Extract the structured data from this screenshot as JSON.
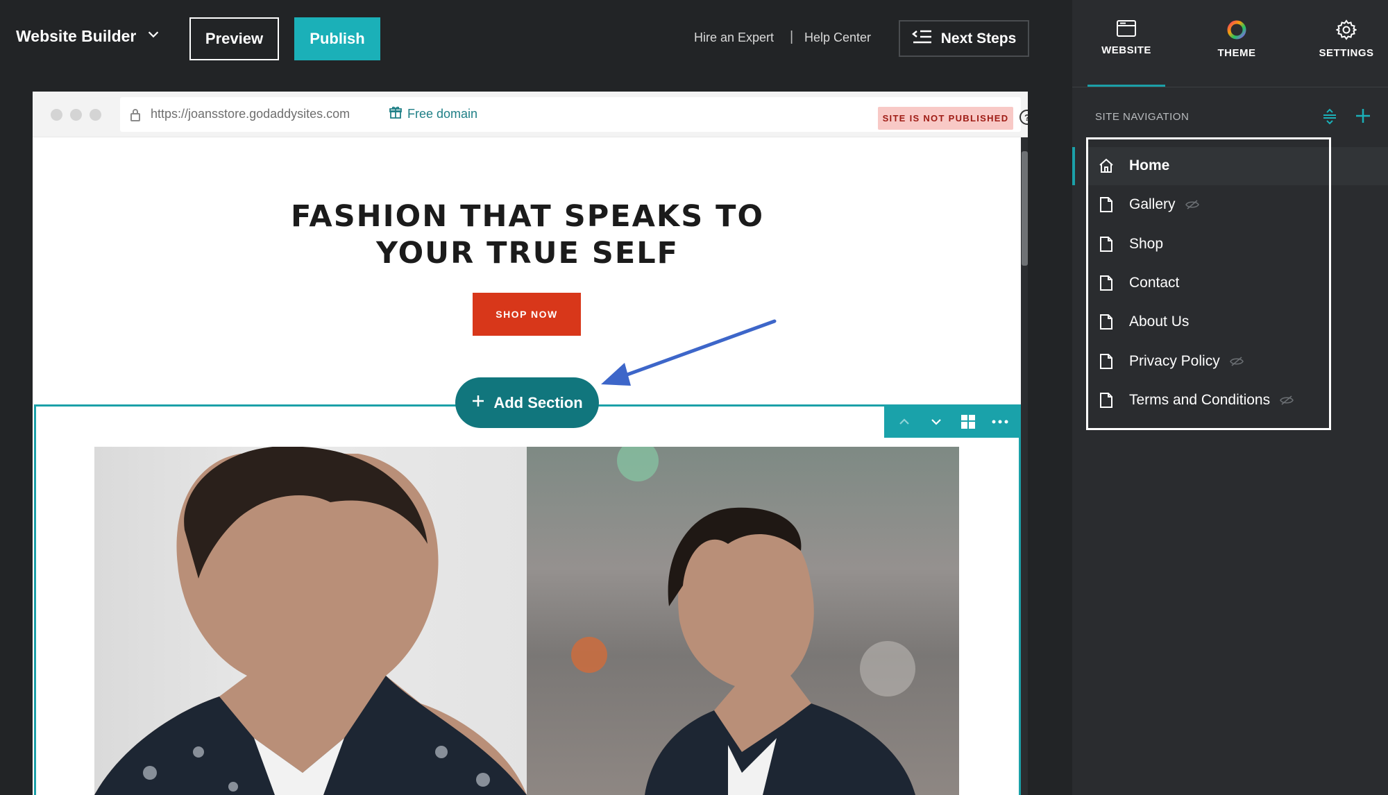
{
  "topbar": {
    "brand": "Website Builder",
    "preview_label": "Preview",
    "publish_label": "Publish",
    "hire_expert": "Hire an Expert",
    "separator": "|",
    "help_center": "Help Center",
    "next_steps_label": "Next Steps"
  },
  "browser": {
    "url": "https://joansstore.godaddysites.com",
    "free_domain": "Free domain",
    "status_badge": "SITE IS NOT PUBLISHED",
    "help_glyph": "?"
  },
  "hero": {
    "title_line1": "FASHION THAT SPEAKS TO",
    "title_line2": "YOUR TRUE SELF",
    "cta": "SHOP NOW"
  },
  "editor": {
    "add_section_label": "Add Section"
  },
  "panel": {
    "tabs": [
      {
        "label": "WEBSITE",
        "icon": "website-icon",
        "active": true
      },
      {
        "label": "THEME",
        "icon": "theme-icon",
        "active": false
      },
      {
        "label": "SETTINGS",
        "icon": "gear-icon",
        "active": false
      }
    ],
    "site_navigation_heading": "SITE NAVIGATION",
    "pages": [
      {
        "label": "Home",
        "icon": "home-icon",
        "hidden": false
      },
      {
        "label": "Gallery",
        "icon": "page-icon",
        "hidden": true
      },
      {
        "label": "Shop",
        "icon": "page-icon",
        "hidden": false
      },
      {
        "label": "Contact",
        "icon": "page-icon",
        "hidden": false
      },
      {
        "label": "About Us",
        "icon": "page-icon",
        "hidden": false
      },
      {
        "label": "Privacy Policy",
        "icon": "page-icon",
        "hidden": true
      },
      {
        "label": "Terms and Conditions",
        "icon": "page-icon",
        "hidden": true
      }
    ]
  },
  "colors": {
    "accent": "#1bb0b8",
    "add_section": "#11767d",
    "cta": "#d8371a",
    "badge_bg": "#f8c9c6",
    "annotation_arrow": "#3d66c9"
  }
}
